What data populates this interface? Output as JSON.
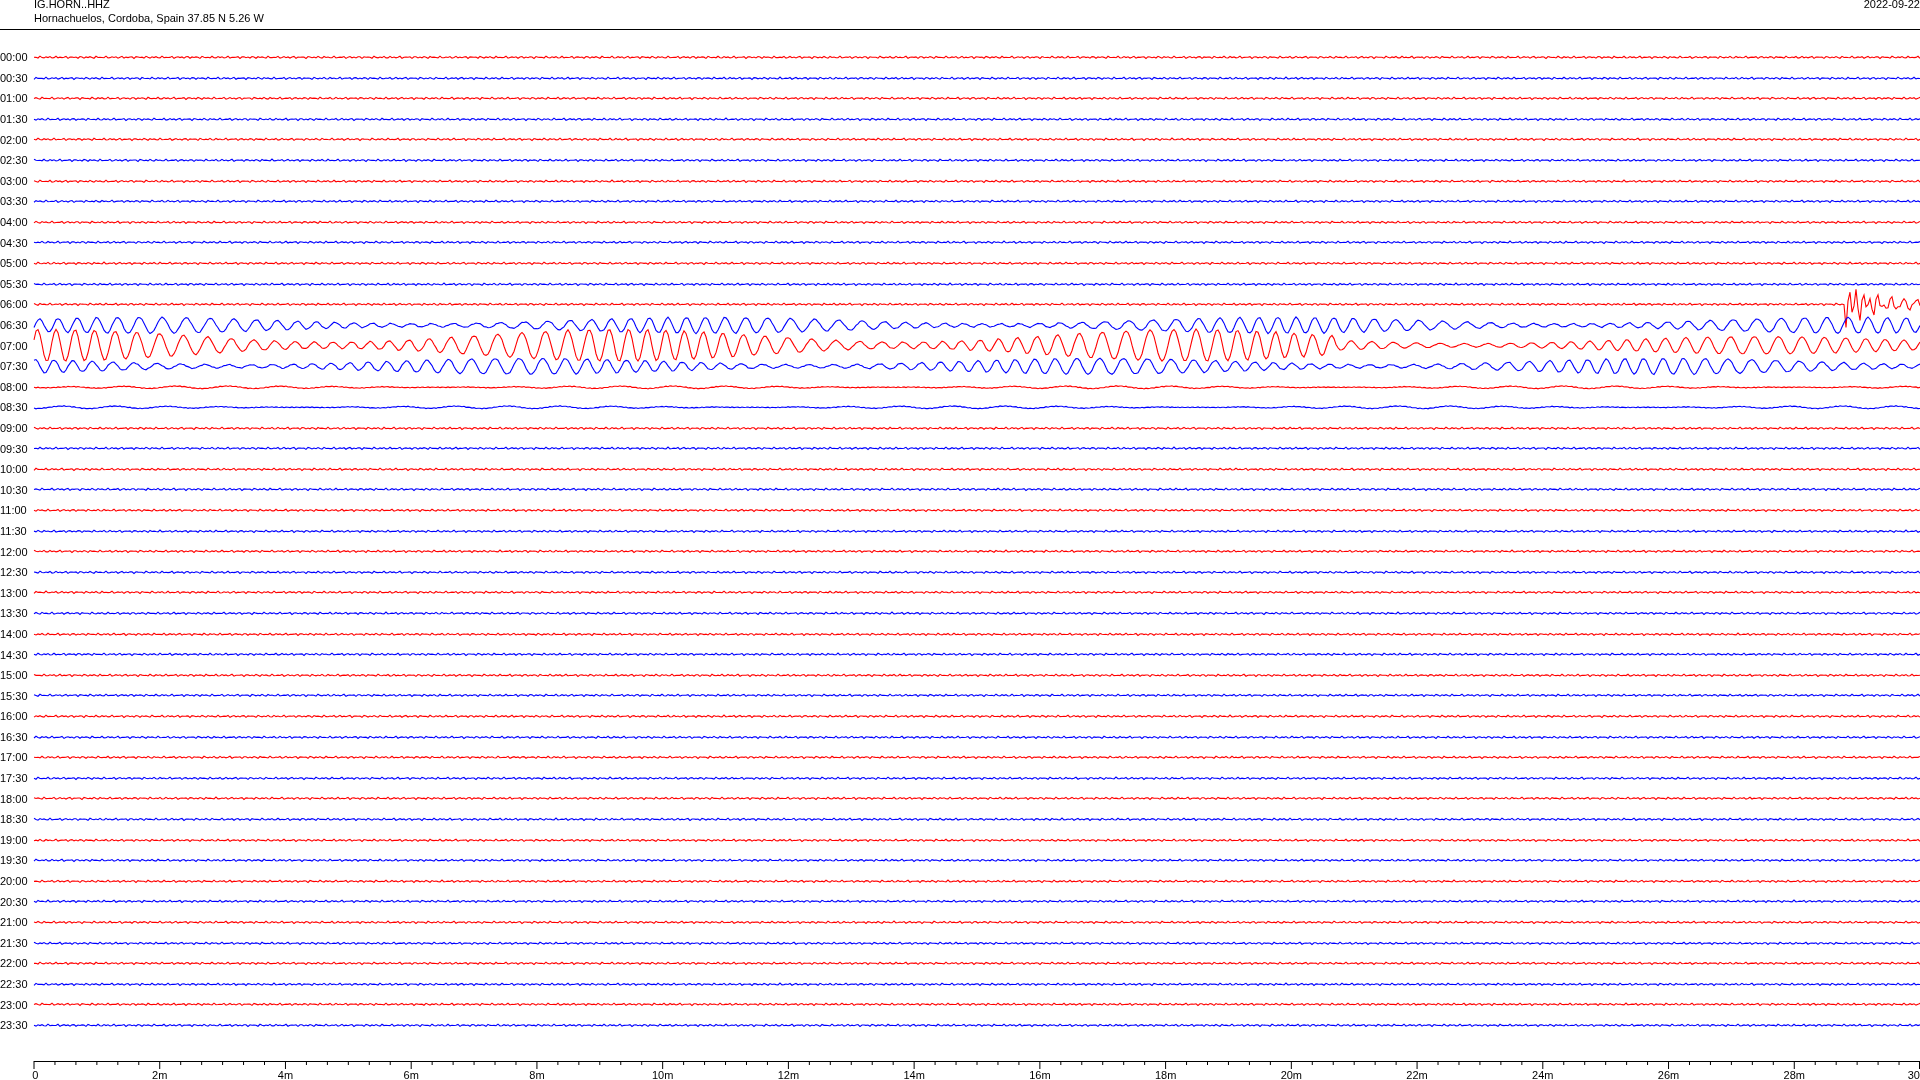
{
  "header": {
    "station": "IG.HORN..HHZ",
    "location": "Hornachuelos, Cordoba, Spain  37.85 N 5.26 W",
    "date": "2022-09-22"
  },
  "rows": [
    {
      "label": "00:00",
      "color": "#ff0000",
      "kind": "quiet"
    },
    {
      "label": "00:30",
      "color": "#0000ff",
      "kind": "quiet"
    },
    {
      "label": "01:00",
      "color": "#ff0000",
      "kind": "quiet"
    },
    {
      "label": "01:30",
      "color": "#0000ff",
      "kind": "quiet"
    },
    {
      "label": "02:00",
      "color": "#ff0000",
      "kind": "quiet"
    },
    {
      "label": "02:30",
      "color": "#0000ff",
      "kind": "quiet"
    },
    {
      "label": "03:00",
      "color": "#ff0000",
      "kind": "quiet"
    },
    {
      "label": "03:30",
      "color": "#0000ff",
      "kind": "quiet"
    },
    {
      "label": "04:00",
      "color": "#ff0000",
      "kind": "quiet"
    },
    {
      "label": "04:30",
      "color": "#0000ff",
      "kind": "quiet"
    },
    {
      "label": "05:00",
      "color": "#ff0000",
      "kind": "quiet"
    },
    {
      "label": "05:30",
      "color": "#0000ff",
      "kind": "quiet"
    },
    {
      "label": "06:00",
      "color": "#ff0000",
      "kind": "event"
    },
    {
      "label": "06:30",
      "color": "#0000ff",
      "kind": "swell"
    },
    {
      "label": "07:00",
      "color": "#ff0000",
      "kind": "strong"
    },
    {
      "label": "07:30",
      "color": "#0000ff",
      "kind": "swell"
    },
    {
      "label": "08:00",
      "color": "#ff0000",
      "kind": "ripple"
    },
    {
      "label": "08:30",
      "color": "#0000ff",
      "kind": "ripple"
    },
    {
      "label": "09:00",
      "color": "#ff0000",
      "kind": "quiet"
    },
    {
      "label": "09:30",
      "color": "#0000ff",
      "kind": "quiet"
    },
    {
      "label": "10:00",
      "color": "#ff0000",
      "kind": "quiet"
    },
    {
      "label": "10:30",
      "color": "#0000ff",
      "kind": "quiet"
    },
    {
      "label": "11:00",
      "color": "#ff0000",
      "kind": "quiet"
    },
    {
      "label": "11:30",
      "color": "#0000ff",
      "kind": "quiet"
    },
    {
      "label": "12:00",
      "color": "#ff0000",
      "kind": "quiet"
    },
    {
      "label": "12:30",
      "color": "#0000ff",
      "kind": "quiet"
    },
    {
      "label": "13:00",
      "color": "#ff0000",
      "kind": "quiet"
    },
    {
      "label": "13:30",
      "color": "#0000ff",
      "kind": "quiet"
    },
    {
      "label": "14:00",
      "color": "#ff0000",
      "kind": "quiet"
    },
    {
      "label": "14:30",
      "color": "#0000ff",
      "kind": "quiet"
    },
    {
      "label": "15:00",
      "color": "#ff0000",
      "kind": "quiet"
    },
    {
      "label": "15:30",
      "color": "#0000ff",
      "kind": "quiet"
    },
    {
      "label": "16:00",
      "color": "#ff0000",
      "kind": "quiet"
    },
    {
      "label": "16:30",
      "color": "#0000ff",
      "kind": "quiet"
    },
    {
      "label": "17:00",
      "color": "#ff0000",
      "kind": "quiet"
    },
    {
      "label": "17:30",
      "color": "#0000ff",
      "kind": "quiet"
    },
    {
      "label": "18:00",
      "color": "#ff0000",
      "kind": "quiet"
    },
    {
      "label": "18:30",
      "color": "#0000ff",
      "kind": "quiet"
    },
    {
      "label": "19:00",
      "color": "#ff0000",
      "kind": "quiet"
    },
    {
      "label": "19:30",
      "color": "#0000ff",
      "kind": "quiet"
    },
    {
      "label": "20:00",
      "color": "#ff0000",
      "kind": "quiet"
    },
    {
      "label": "20:30",
      "color": "#0000ff",
      "kind": "quiet"
    },
    {
      "label": "21:00",
      "color": "#ff0000",
      "kind": "quiet"
    },
    {
      "label": "21:30",
      "color": "#0000ff",
      "kind": "quiet"
    },
    {
      "label": "22:00",
      "color": "#ff0000",
      "kind": "quiet"
    },
    {
      "label": "22:30",
      "color": "#0000ff",
      "kind": "quiet"
    },
    {
      "label": "23:00",
      "color": "#ff0000",
      "kind": "quiet"
    },
    {
      "label": "23:30",
      "color": "#0000ff",
      "kind": "quiet"
    }
  ],
  "time_axis": {
    "labels": [
      "0",
      "2m",
      "4m",
      "6m",
      "8m",
      "10m",
      "12m",
      "14m",
      "16m",
      "18m",
      "20m",
      "22m",
      "24m",
      "26m",
      "28m",
      "30"
    ]
  }
}
